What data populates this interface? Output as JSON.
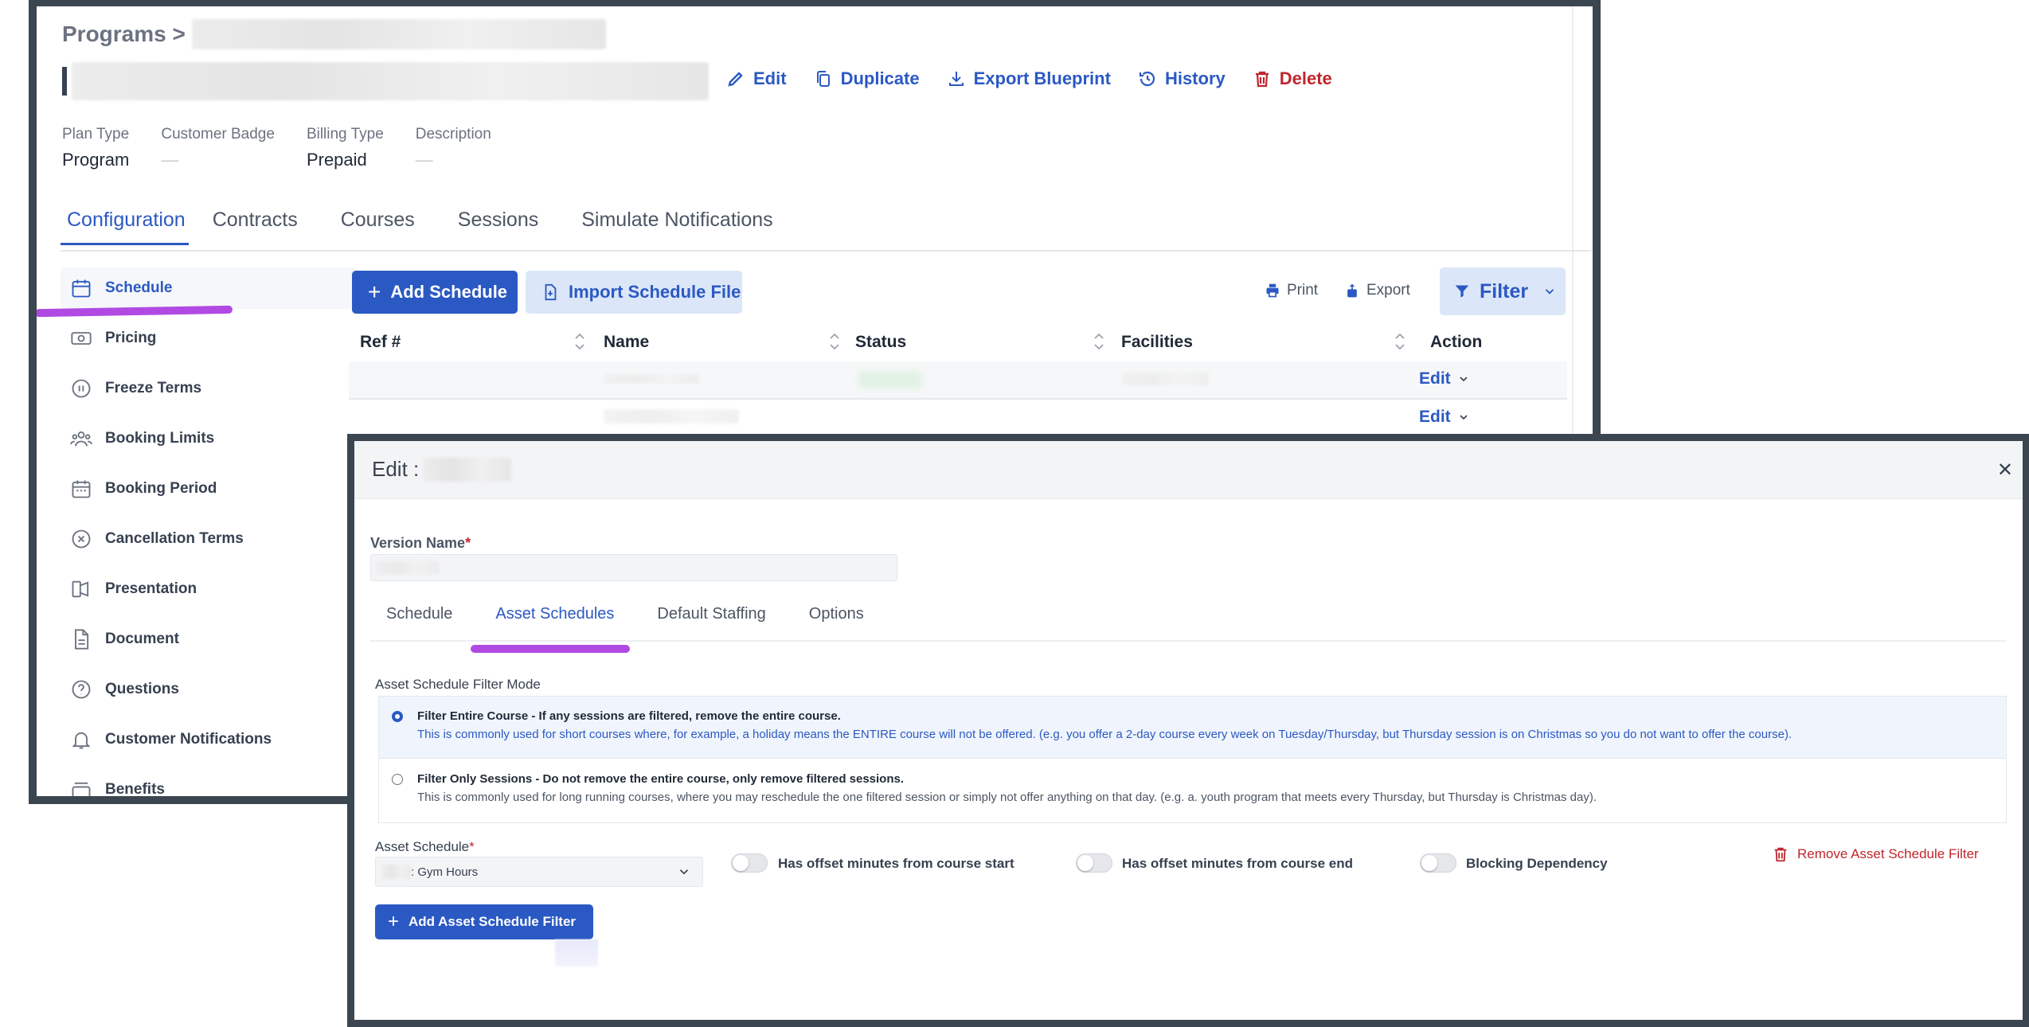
{
  "background": {
    "breadcrumb": "Programs >",
    "actions": {
      "edit": "Edit",
      "duplicate": "Duplicate",
      "export_blueprint": "Export Blueprint",
      "history": "History",
      "delete": "Delete"
    },
    "meta": [
      {
        "key": "Plan Type",
        "value": "Program"
      },
      {
        "key": "Customer Badge",
        "value": "—"
      },
      {
        "key": "Billing Type",
        "value": "Prepaid"
      },
      {
        "key": "Description",
        "value": "—"
      }
    ],
    "tabs": [
      "Configuration",
      "Contracts",
      "Courses",
      "Sessions",
      "Simulate Notifications"
    ],
    "sidebar": [
      {
        "label": "Schedule",
        "icon": "calendar-icon"
      },
      {
        "label": "Pricing",
        "icon": "money-icon"
      },
      {
        "label": "Freeze Terms",
        "icon": "pause-circle-icon"
      },
      {
        "label": "Booking Limits",
        "icon": "users-icon"
      },
      {
        "label": "Booking Period",
        "icon": "calendar-range-icon"
      },
      {
        "label": "Cancellation Terms",
        "icon": "x-circle-icon"
      },
      {
        "label": "Presentation",
        "icon": "presentation-icon"
      },
      {
        "label": "Document",
        "icon": "document-icon"
      },
      {
        "label": "Questions",
        "icon": "question-circle-icon"
      },
      {
        "label": "Customer Notifications",
        "icon": "bell-icon"
      },
      {
        "label": "Benefits",
        "icon": "gift-box-icon"
      }
    ],
    "toolbar": {
      "add_schedule": "Add Schedule",
      "import_schedule_file": "Import Schedule File",
      "print": "Print",
      "export": "Export",
      "filter": "Filter"
    },
    "table": {
      "columns": [
        "Ref #",
        "Name",
        "Status",
        "Facilities",
        "Action"
      ],
      "row_action": "Edit"
    }
  },
  "modal": {
    "title": "Edit :",
    "version_name_label": "Version Name",
    "required_mark": "*",
    "tabs": [
      "Schedule",
      "Asset Schedules",
      "Default Staffing",
      "Options"
    ],
    "filter_mode_label": "Asset Schedule Filter Mode",
    "options": [
      {
        "title": "Filter Entire Course - If any sessions are filtered, remove the entire course.",
        "desc": "This is commonly used for short courses where, for example, a holiday means the ENTIRE course will not be offered. (e.g. you offer a 2-day course every week on Tuesday/Thursday, but Thursday session is on Christmas so you do not want to offer the course)."
      },
      {
        "title": "Filter Only Sessions - Do not remove the entire course, only remove filtered sessions.",
        "desc": "This is commonly used for long running courses, where you may reschedule the one filtered session or simply not offer anything on that day. (e.g. a. youth program that meets every Thursday, but Thursday is Christmas day)."
      }
    ],
    "asset_schedule_label": "Asset Schedule",
    "asset_schedule_value": ": Gym Hours",
    "toggles": [
      "Has offset minutes from course start",
      "Has offset minutes from course end",
      "Blocking Dependency"
    ],
    "remove_filter": "Remove Asset Schedule Filter",
    "add_filter": "Add Asset Schedule Filter"
  },
  "colors": {
    "accent": "#2b59c3",
    "danger": "#c0262d",
    "highlight": "#b14ae3",
    "frame": "#3b4650"
  }
}
